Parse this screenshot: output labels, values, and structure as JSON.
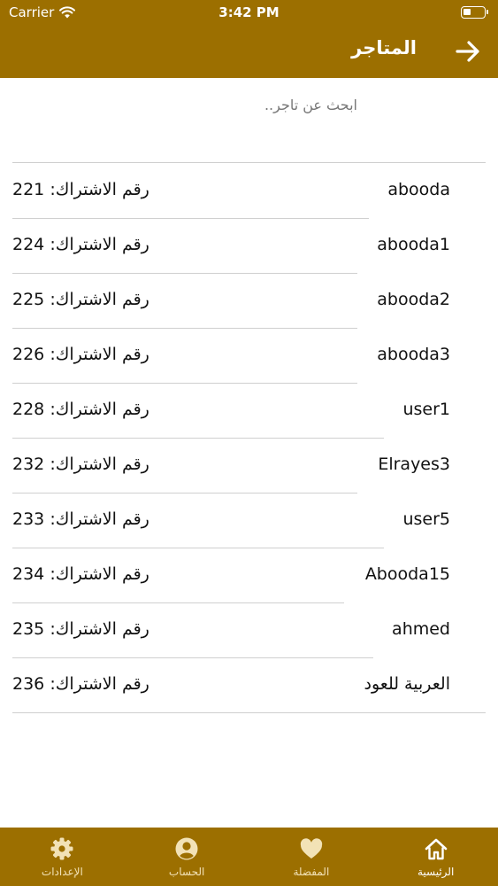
{
  "status_bar": {
    "carrier": "Carrier",
    "time": "3:42 PM"
  },
  "header": {
    "title": "المتاجر",
    "back_icon": "arrow-right-icon"
  },
  "search": {
    "placeholder": "ابحث عن تاجر..",
    "value": ""
  },
  "subscription_label": "رقم الاشتراك:",
  "merchants": [
    {
      "name": "abooda",
      "id": "221"
    },
    {
      "name": "abooda1",
      "id": "224"
    },
    {
      "name": "abooda2",
      "id": "225"
    },
    {
      "name": "abooda3",
      "id": "226"
    },
    {
      "name": "user1",
      "id": "228"
    },
    {
      "name": "Elrayes3",
      "id": "232"
    },
    {
      "name": "user5",
      "id": "233"
    },
    {
      "name": "Abooda15",
      "id": "234"
    },
    {
      "name": "ahmed",
      "id": "235"
    },
    {
      "name": "العربية للعود",
      "id": "236"
    }
  ],
  "tabs": [
    {
      "label": "الرئيسية",
      "icon": "home-icon",
      "active": true
    },
    {
      "label": "المفضلة",
      "icon": "heart-icon",
      "active": false
    },
    {
      "label": "الحساب",
      "icon": "user-icon",
      "active": false
    },
    {
      "label": "الإعدادات",
      "icon": "gear-icon",
      "active": false
    }
  ],
  "colors": {
    "primary": "#9c6f00",
    "tab_inactive": "#f2e2b6",
    "separator": "#cfcfcf"
  }
}
